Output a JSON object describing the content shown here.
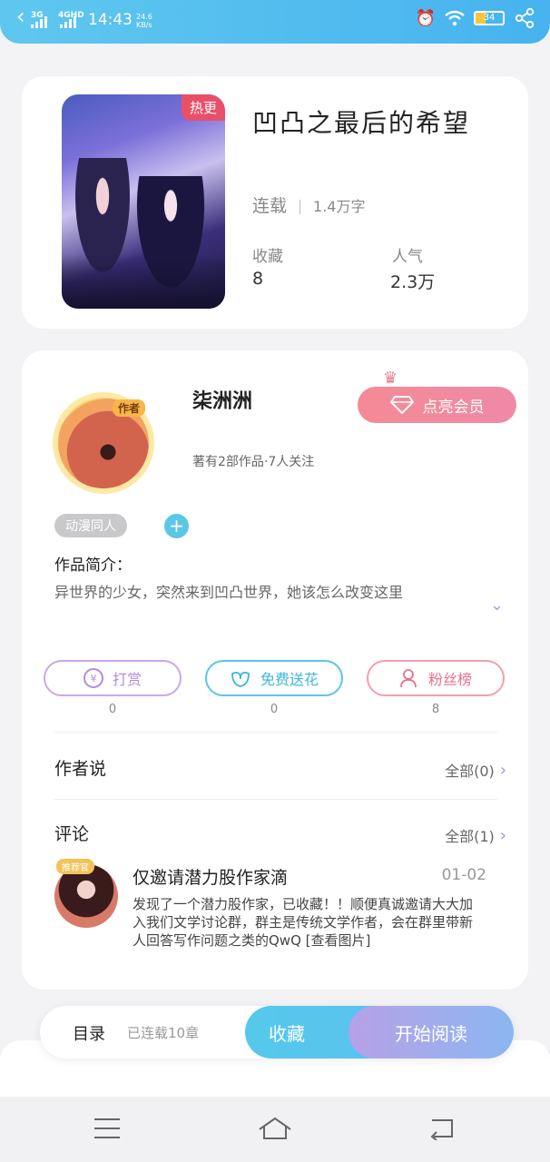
{
  "status_bar": {
    "network1": "3G",
    "network2": "4GHD",
    "time": "14:43",
    "speed_value": "24.6",
    "speed_unit": "KB/s",
    "battery": "34"
  },
  "book": {
    "hot_badge": "热更",
    "title": "凹凸之最后的希望",
    "status": "连载",
    "word_count": "1.4万字",
    "favorites_label": "收藏",
    "favorites_value": "8",
    "popularity_label": "人气",
    "popularity_value": "2.3万"
  },
  "author": {
    "badge": "作者",
    "name": "柒洲洲",
    "meta": "著有2部作品·7人关注",
    "vip_button": "点亮会员"
  },
  "tags": [
    "动漫同人"
  ],
  "intro": {
    "label": "作品简介：",
    "text": "异世界的少女，突然来到凹凸世界，她该怎么改变这里"
  },
  "actions": [
    {
      "label": "打赏",
      "count": "0",
      "color": "#b48be0"
    },
    {
      "label": "免费送花",
      "count": "0",
      "color": "#5cc6e6"
    },
    {
      "label": "粉丝榜",
      "count": "8",
      "color": "#f08aa0"
    }
  ],
  "author_says": {
    "title": "作者说",
    "more": "全部(0)"
  },
  "comments": {
    "title": "评论",
    "more": "全部(1)",
    "items": [
      {
        "badge": "推荐官",
        "name": "仅邀请潜力股作家滴",
        "date": "01-02",
        "text": "发现了一个潜力股作家，已收藏！！顺便真诚邀请大大加入我们文学讨论群，群主是传统文学作者，会在群里带新人回答写作问题之类的QwQ [查看图片]"
      }
    ]
  },
  "bottom_bar": {
    "toc": "目录",
    "toc_sub": "已连载10章",
    "favorite": "收藏",
    "read": "开始阅读"
  }
}
